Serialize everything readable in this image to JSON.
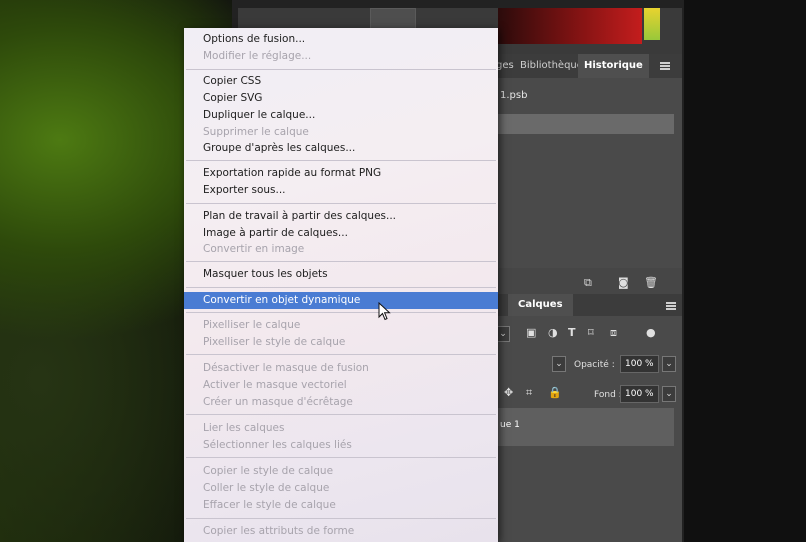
{
  "photoshop": {
    "tabs_history": {
      "partial": "ges",
      "bibliotheque": "Bibliothèque",
      "historique": "Historique"
    },
    "history_file": "1.psb",
    "tab_layers": "Calques",
    "opacity_label": "Opacité :",
    "opacity_value": "100 %",
    "fill_label": "Fond :",
    "fill_value": "100 %",
    "layer_name": "ue 1"
  },
  "context_menu": {
    "group1": [
      {
        "label": "Options de fusion...",
        "enabled": true
      },
      {
        "label": "Modifier le réglage...",
        "enabled": false
      }
    ],
    "group2": [
      {
        "label": "Copier CSS",
        "enabled": true
      },
      {
        "label": "Copier SVG",
        "enabled": true
      },
      {
        "label": "Dupliquer le calque...",
        "enabled": true
      },
      {
        "label": "Supprimer le calque",
        "enabled": false
      },
      {
        "label": "Groupe d'après les calques...",
        "enabled": true
      }
    ],
    "group3": [
      {
        "label": "Exportation rapide au format PNG",
        "enabled": true
      },
      {
        "label": "Exporter sous...",
        "enabled": true
      }
    ],
    "group4": [
      {
        "label": "Plan de travail à partir des calques...",
        "enabled": true
      },
      {
        "label": "Image à partir de calques...",
        "enabled": true
      },
      {
        "label": "Convertir en image",
        "enabled": false
      }
    ],
    "group5": [
      {
        "label": "Masquer tous les objets",
        "enabled": true
      }
    ],
    "group6": [
      {
        "label": "Convertir en objet dynamique",
        "enabled": true,
        "highlighted": true
      }
    ],
    "group7": [
      {
        "label": "Pixelliser le calque",
        "enabled": false
      },
      {
        "label": "Pixelliser le style de calque",
        "enabled": false
      }
    ],
    "group8": [
      {
        "label": "Désactiver le masque de fusion",
        "enabled": false
      },
      {
        "label": "Activer le masque vectoriel",
        "enabled": false
      },
      {
        "label": "Créer un masque d'écrêtage",
        "enabled": false
      }
    ],
    "group9": [
      {
        "label": "Lier les calques",
        "enabled": false
      },
      {
        "label": "Sélectionner les calques liés",
        "enabled": false
      }
    ],
    "group10": [
      {
        "label": "Copier le style de calque",
        "enabled": false
      },
      {
        "label": "Coller le style de calque",
        "enabled": false
      },
      {
        "label": "Effacer le style de calque",
        "enabled": false
      }
    ],
    "group11": [
      {
        "label": "Copier les attributs de forme",
        "enabled": false
      }
    ]
  },
  "colors": {
    "highlight": "#4a7cd3",
    "menu_text": "#1d1d1d",
    "menu_disabled": "#a7a3ac",
    "panel_bg": "#464646"
  },
  "icons": [
    "panel-menu-icon",
    "new-layer-icon",
    "camera-icon",
    "trash-icon",
    "image-filter-icon",
    "adjustment-filter-icon",
    "type-filter-icon",
    "shape-filter-icon",
    "smart-object-filter-icon",
    "move-lock-icon",
    "artboard-lock-icon",
    "lock-all-icon",
    "mouse-cursor-icon"
  ]
}
